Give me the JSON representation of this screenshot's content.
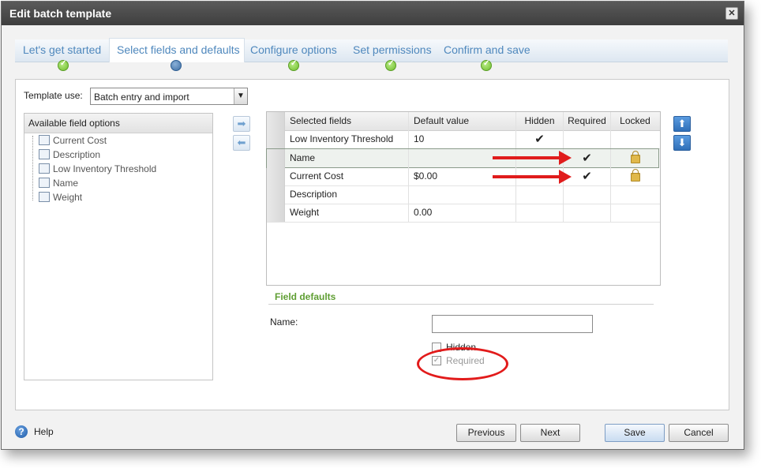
{
  "dialog": {
    "title": "Edit batch template",
    "close_label": "✕"
  },
  "wizard": {
    "steps": [
      {
        "label": "Let's get started",
        "state": "done"
      },
      {
        "label": "Select fields and defaults",
        "state": "current"
      },
      {
        "label": "Configure options",
        "state": "done"
      },
      {
        "label": "Set permissions",
        "state": "done"
      },
      {
        "label": "Confirm and save",
        "state": "done"
      }
    ]
  },
  "template_use": {
    "label": "Template use:",
    "value": "Batch entry and import",
    "dropdown_glyph": "▼"
  },
  "available": {
    "header": "Available field options",
    "items": [
      "Current Cost",
      "Description",
      "Low Inventory Threshold",
      "Name",
      "Weight"
    ]
  },
  "move_buttons": {
    "add": "➡",
    "remove": "⬅",
    "up": "⬆",
    "down": "⬇"
  },
  "grid": {
    "headers": [
      "Selected fields",
      "Default value",
      "Hidden",
      "Required",
      "Locked"
    ],
    "rows": [
      {
        "field": "Low Inventory Threshold",
        "default": "10",
        "hidden": "✔",
        "required": "",
        "locked": false
      },
      {
        "field": "Name",
        "default": "",
        "hidden": "",
        "required": "✔",
        "locked": true
      },
      {
        "field": "Current Cost",
        "default": "$0.00",
        "hidden": "",
        "required": "✔",
        "locked": true
      },
      {
        "field": "Description",
        "default": "",
        "hidden": "",
        "required": "",
        "locked": false
      },
      {
        "field": "Weight",
        "default": "0.00",
        "hidden": "",
        "required": "",
        "locked": false
      }
    ]
  },
  "field_defaults": {
    "title": "Field defaults",
    "name_label": "Name:",
    "name_value": "",
    "hidden_label": "Hidden",
    "required_label": "Required",
    "required_checked_glyph": "✓"
  },
  "footer": {
    "help_glyph": "?",
    "help": "Help",
    "previous": "Previous",
    "next": "Next",
    "save": "Save",
    "cancel": "Cancel"
  },
  "colors": {
    "accent": "#4f88bd",
    "section": "#5f9e33",
    "annotation": "#e01c1c"
  }
}
